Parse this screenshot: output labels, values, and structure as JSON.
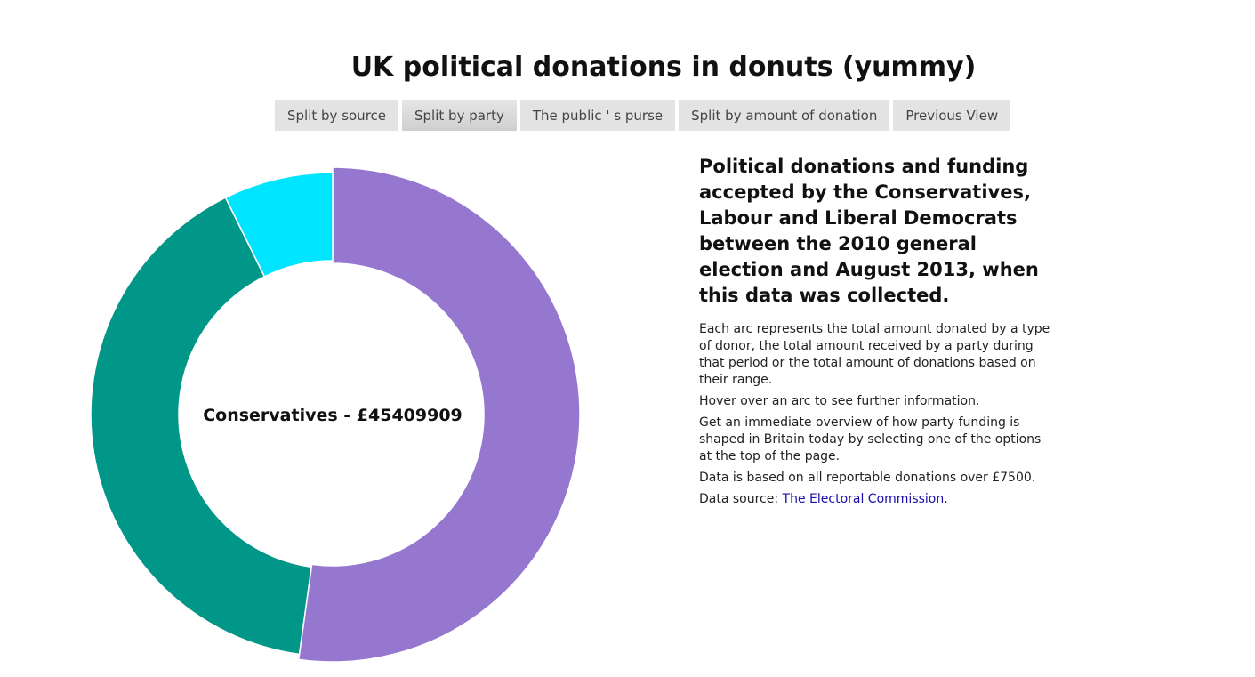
{
  "header": {
    "title": "UK political donations in donuts (yummy)"
  },
  "nav": {
    "buttons": [
      {
        "label": "Split by source"
      },
      {
        "label": "Split by party",
        "active": true
      },
      {
        "label": "The public ' s purse"
      },
      {
        "label": "Split by amount of donation"
      },
      {
        "label": "Previous View"
      }
    ]
  },
  "info": {
    "heading": "Political donations and funding accepted by the Conservatives, Labour and Liberal Democrats between the 2010 general election and August 2013, when this data was collected.",
    "paragraphs": [
      "Each arc represents the total amount donated by a type of donor, the total amount received by a party during that period or the total amount of donations based on their range.",
      "Hover over an arc to see further information.",
      "Get an immediate overview of how party funding is shaped in Britain today by selecting one of the options at the top of the page.",
      "Data is based on all reportable donations over £7500."
    ],
    "source_prefix": "Data source: ",
    "source_link_text": "The Electoral Commission."
  },
  "chart_data": {
    "type": "pie",
    "variant": "donut",
    "center_label": "Conservatives - £45409909",
    "slices": [
      {
        "fraction": 0.522,
        "color": "#9677cf"
      },
      {
        "fraction": 0.405,
        "color": "#009688"
      },
      {
        "fraction": 0.073,
        "color": "#00e5ff"
      }
    ],
    "highlighted_slice": 0
  }
}
